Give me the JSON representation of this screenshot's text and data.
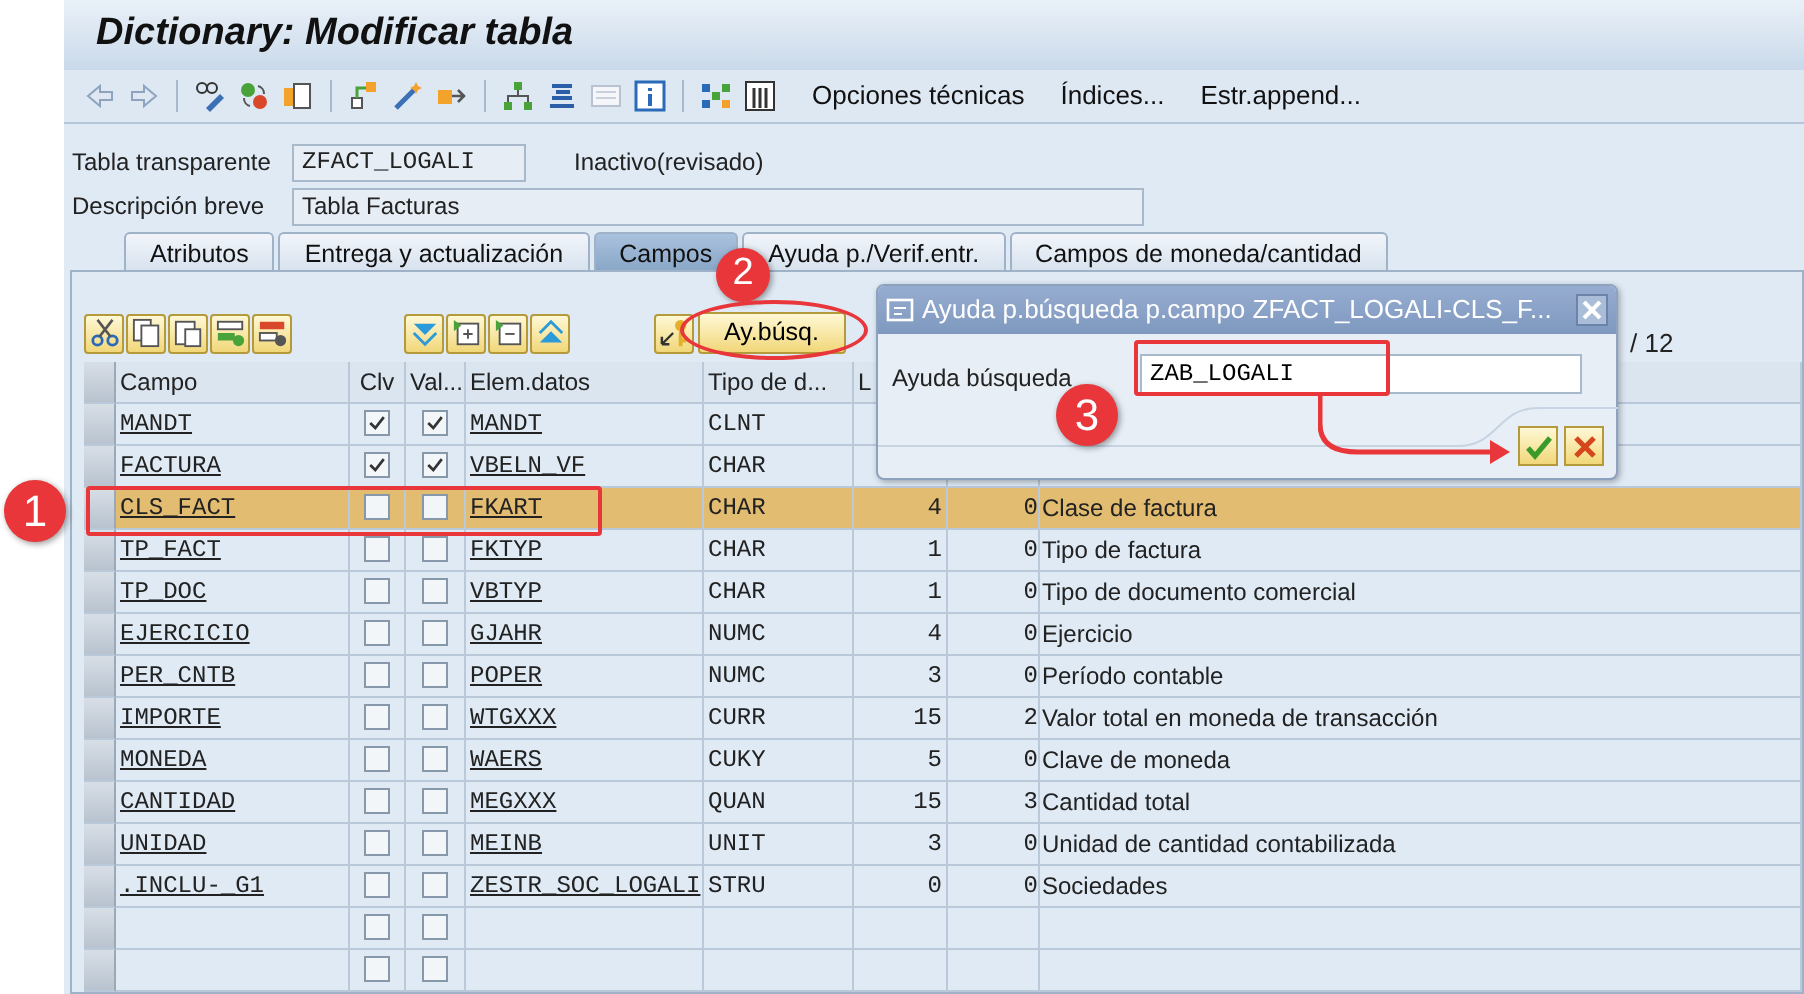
{
  "window": {
    "title": "Dictionary: Modificar tabla"
  },
  "toolbar": {
    "menu_buttons": [
      "Opciones técnicas",
      "Índices...",
      "Estr.append..."
    ]
  },
  "header": {
    "table_label": "Tabla transparente",
    "table_name": "ZFACT_LOGALI",
    "status": "Inactivo(revisado)",
    "description_label": "Descripción breve",
    "description": "Tabla Facturas"
  },
  "tabs": [
    {
      "label": "Atributos",
      "selected": false
    },
    {
      "label": "Entrega y actualización",
      "selected": false
    },
    {
      "label": "Campos",
      "selected": true
    },
    {
      "label": "Ayuda p./Verif.entr.",
      "selected": false
    },
    {
      "label": "Campos de moneda/cantidad",
      "selected": false
    }
  ],
  "fields_toolbar": {
    "search_help_button": "Ay.búsq.",
    "counter": "/ 12"
  },
  "table": {
    "columns": [
      "Campo",
      "Clv",
      "Val...",
      "Elem.datos",
      "Tipo de d...",
      "L"
    ],
    "rows": [
      {
        "field": "MANDT",
        "key": true,
        "initial": true,
        "element": "MANDT",
        "type": "CLNT",
        "selected": false
      },
      {
        "field": "FACTURA",
        "key": true,
        "initial": true,
        "element": "VBELN_VF",
        "type": "CHAR",
        "selected": false
      },
      {
        "field": "CLS_FACT",
        "key": false,
        "initial": false,
        "element": "FKART",
        "type": "CHAR",
        "length": "4",
        "decimals": "0",
        "description": "Clase de factura",
        "selected": true
      },
      {
        "field": "TP_FACT",
        "key": false,
        "initial": false,
        "element": "FKTYP",
        "type": "CHAR",
        "length": "1",
        "decimals": "0",
        "description": "Tipo de factura",
        "selected": false
      },
      {
        "field": "TP_DOC",
        "key": false,
        "initial": false,
        "element": "VBTYP",
        "type": "CHAR",
        "length": "1",
        "decimals": "0",
        "description": "Tipo de documento comercial",
        "selected": false
      },
      {
        "field": "EJERCICIO",
        "key": false,
        "initial": false,
        "element": "GJAHR",
        "type": "NUMC",
        "length": "4",
        "decimals": "0",
        "description": "Ejercicio",
        "selected": false
      },
      {
        "field": "PER_CNTB",
        "key": false,
        "initial": false,
        "element": "POPER",
        "type": "NUMC",
        "length": "3",
        "decimals": "0",
        "description": "Período contable",
        "selected": false
      },
      {
        "field": "IMPORTE",
        "key": false,
        "initial": false,
        "element": "WTGXXX",
        "type": "CURR",
        "length": "15",
        "decimals": "2",
        "description": "Valor total en moneda de transacción",
        "selected": false
      },
      {
        "field": "MONEDA",
        "key": false,
        "initial": false,
        "element": "WAERS",
        "type": "CUKY",
        "length": "5",
        "decimals": "0",
        "description": "Clave de moneda",
        "selected": false
      },
      {
        "field": "CANTIDAD",
        "key": false,
        "initial": false,
        "element": "MEGXXX",
        "type": "QUAN",
        "length": "15",
        "decimals": "3",
        "description": "Cantidad total",
        "selected": false
      },
      {
        "field": "UNIDAD",
        "key": false,
        "initial": false,
        "element": "MEINB",
        "type": "UNIT",
        "length": "3",
        "decimals": "0",
        "description": "Unidad de cantidad contabilizada",
        "selected": false
      },
      {
        "field": ".INCLU-_G1",
        "key": false,
        "initial": false,
        "element": "ZESTR_SOC_LOGALI",
        "type": "STRU",
        "length": "0",
        "decimals": "0",
        "description": "Sociedades",
        "selected": false
      },
      {
        "key": false,
        "initial": false,
        "selected": false
      },
      {
        "key": false,
        "initial": false,
        "selected": false
      }
    ]
  },
  "dialog": {
    "title": "Ayuda p.búsqueda  p.campo ZFACT_LOGALI-CLS_F...",
    "field_label": "Ayuda búsqueda",
    "field_value": "ZAB_LOGALI"
  },
  "annotations": [
    {
      "number": "1"
    },
    {
      "number": "2"
    },
    {
      "number": "3"
    }
  ]
}
